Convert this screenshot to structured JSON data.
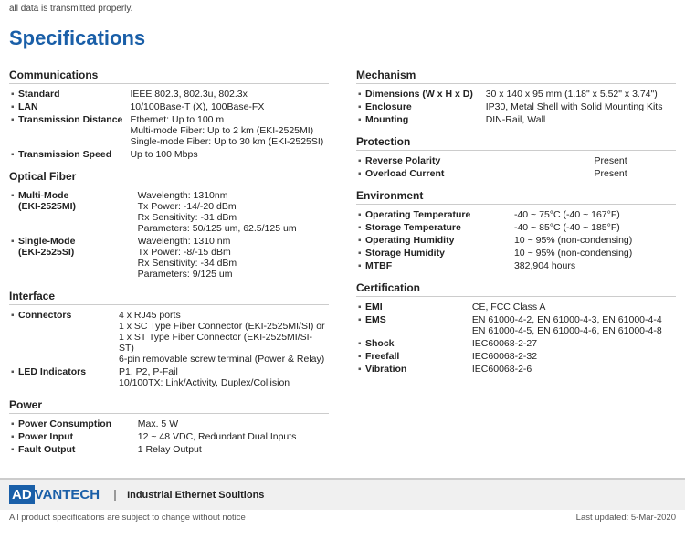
{
  "top_note": "all data is transmitted properly.",
  "page_title": "Specifications",
  "left_col": {
    "sections": [
      {
        "title": "Communications",
        "rows": [
          {
            "label": "Standard",
            "value": "IEEE 802.3, 802.3u, 802.3x"
          },
          {
            "label": "LAN",
            "value": "10/100Base-T (X), 100Base-FX"
          },
          {
            "label": "Transmission Distance",
            "value": "Ethernet: Up to 100 m\nMulti-mode Fiber: Up to 2 km (EKI-2525MI)\nSingle-mode Fiber: Up to 30 km (EKI-2525SI)"
          },
          {
            "label": "Transmission Speed",
            "value": "Up to 100 Mbps"
          }
        ]
      },
      {
        "title": "Optical Fiber",
        "rows": [
          {
            "label": "Multi-Mode\n(EKI-2525MI)",
            "value": "Wavelength: 1310nm\nTx Power: -14/-20 dBm\nRx Sensitivity: -31 dBm\nParameters: 50/125 um, 62.5/125 um"
          },
          {
            "label": "Single-Mode\n(EKI-2525SI)",
            "value": "Wavelength: 1310 nm\nTx Power: -8/-15 dBm\nRx Sensitivity: -34 dBm\nParameters: 9/125 um"
          }
        ]
      },
      {
        "title": "Interface",
        "rows": [
          {
            "label": "Connectors",
            "value": "4 x RJ45 ports\n1 x SC Type Fiber Connector (EKI-2525MI/SI) or\n1 x ST Type Fiber Connector (EKI-2525MI/SI-ST)\n6-pin removable screw terminal (Power & Relay)"
          },
          {
            "label": "LED Indicators",
            "value": "P1, P2, P-Fail\n10/100TX: Link/Activity, Duplex/Collision"
          }
        ]
      },
      {
        "title": "Power",
        "rows": [
          {
            "label": "Power Consumption",
            "value": "Max. 5 W"
          },
          {
            "label": "Power Input",
            "value": "12 ~ 48 VDC, Redundant Dual Inputs"
          },
          {
            "label": "Fault Output",
            "value": "1 Relay Output"
          }
        ]
      }
    ]
  },
  "right_col": {
    "sections": [
      {
        "title": "Mechanism",
        "rows": [
          {
            "label": "Dimensions (W x H x D)",
            "value": "30 x 140 x 95 mm (1.18\" x 5.52\" x 3.74\")"
          },
          {
            "label": "Enclosure",
            "value": "IP30, Metal Shell with Solid Mounting Kits"
          },
          {
            "label": "Mounting",
            "value": "DIN-Rail, Wall"
          }
        ]
      },
      {
        "title": "Protection",
        "rows": [
          {
            "label": "Reverse Polarity",
            "value": "Present"
          },
          {
            "label": "Overload Current",
            "value": "Present"
          }
        ]
      },
      {
        "title": "Environment",
        "rows": [
          {
            "label": "Operating Temperature",
            "value": "-40 ~ 75°C (-40 ~ 167°F)"
          },
          {
            "label": "Storage Temperature",
            "value": "-40 ~ 85°C (-40 ~ 185°F)"
          },
          {
            "label": "Operating Humidity",
            "value": "10 ~ 95% (non-condensing)"
          },
          {
            "label": "Storage Humidity",
            "value": "10 ~ 95% (non-condensing)"
          },
          {
            "label": "MTBF",
            "value": "382,904 hours"
          }
        ]
      },
      {
        "title": "Certification",
        "rows": [
          {
            "label": "EMI",
            "value": "CE, FCC Class A"
          },
          {
            "label": "EMS",
            "value": "EN 61000-4-2, EN 61000-4-3, EN 61000-4-4\nEN 61000-4-5, EN 61000-4-6, EN 61000-4-8"
          },
          {
            "label": "Shock",
            "value": "IEC60068-2-27"
          },
          {
            "label": "Freefall",
            "value": "IEC60068-2-32"
          },
          {
            "label": "Vibration",
            "value": "IEC60068-2-6"
          }
        ]
      }
    ]
  },
  "footer": {
    "logo_ad": "AD",
    "logo_vantech": "VANTECH",
    "tagline": "Industrial Ethernet Soultions",
    "left_note": "All product specifications are subject to change without notice",
    "right_note": "Last updated: 5-Mar-2020"
  }
}
